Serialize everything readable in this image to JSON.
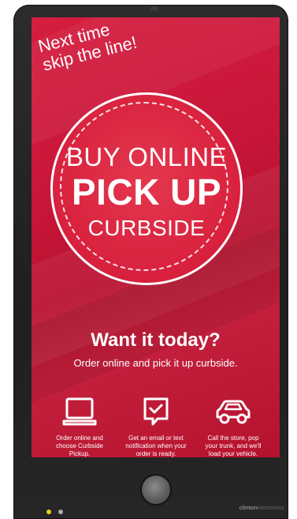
{
  "tagline": {
    "line1": "Next time",
    "line2": "skip the line!"
  },
  "circle": {
    "line1": "BUY ONLINE",
    "line2": "PICK UP",
    "line3": "CURBSIDE"
  },
  "headline": "Want it today?",
  "subheadline": "Order online and pick it up curbside.",
  "steps": [
    {
      "icon": "laptop-icon",
      "line1": "Order online and",
      "line2": "choose Curbside",
      "line3": "Pickup."
    },
    {
      "icon": "message-check-icon",
      "line1": "Get an email or text",
      "line2": "notification when your",
      "line3": "order is ready."
    },
    {
      "icon": "car-icon",
      "line1": "Call the store, pop",
      "line2": "your trunk, and we'll",
      "line3": "load your vehicle."
    }
  ],
  "brand": {
    "bold": "clinton",
    "rest": "electronics"
  },
  "colors": {
    "screen_red": "#c8163a",
    "led_yellow": "#e6d21c",
    "bezel": "#262626"
  }
}
